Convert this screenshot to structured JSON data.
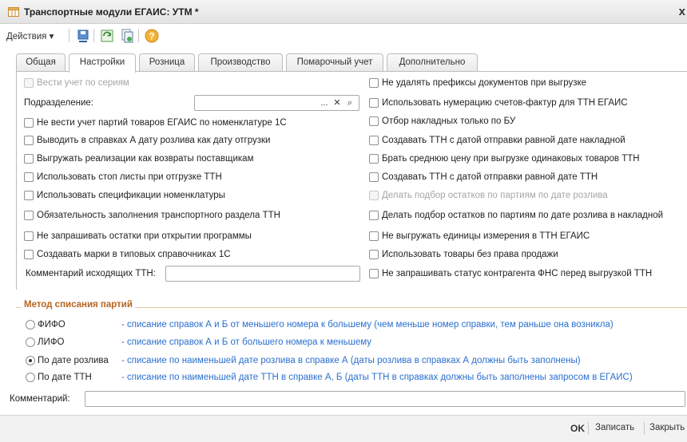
{
  "window": {
    "title": "Транспортные модули ЕГАИС: УТМ *",
    "close_glyph": "x"
  },
  "toolbar": {
    "actions_label": "Действия ▾",
    "icons": [
      "save-close-icon",
      "save-icon",
      "refresh-icon",
      "copy-icon",
      "help-icon"
    ]
  },
  "tabs": [
    {
      "label": "Общая"
    },
    {
      "label": "Настройки"
    },
    {
      "label": "Розница"
    },
    {
      "label": "Производство"
    },
    {
      "label": "Помарочный учет"
    },
    {
      "label": "Дополнительно"
    }
  ],
  "settings": {
    "series_label": "Вести учет по сериям",
    "division_label": "Подразделение:",
    "division_value": "",
    "division_dots": "...",
    "division_clear": "✕",
    "division_search": "⌕",
    "left": [
      "Не вести учет партий товаров ЕГАИС по номенклатуре 1С",
      "Выводить в справках А дату розлива как дату отгрузки",
      "Выгружать реализации как возвраты поставщикам",
      "Использовать стоп листы при отгрузке ТТН",
      "Использовать спецификации номенклатуры",
      "Обязательность заполнения транспортного раздела ТТН",
      "Не запрашивать остатки при открытии программы",
      "Создавать марки в типовых справочниках 1С"
    ],
    "comment_out_label": "Комментарий исходящих ТТН:",
    "comment_out_value": "",
    "right": [
      "Не удалять префиксы документов при выгрузке",
      "Использовать нумерацию счетов-фактур для ТТН ЕГАИС",
      "Отбор накладных только по БУ",
      "Создавать ТТН с датой отправки равной дате накладной",
      "Брать среднюю цену при выгрузке одинаковых товаров ТТН",
      "Создавать ТТН с датой отправки равной дате ТТН",
      "Делать подбор остатков по партиям по дате розлива",
      "Делать подбор остатков по партиям по дате розлива в накладной",
      "Не выгружать единицы измерения в ТТН ЕГАИС",
      "Использовать товары без права продажи",
      "Не запрашивать статус контрагента ФНС перед выгрузкой ТТН"
    ]
  },
  "write_off": {
    "title": "Метод списания партий",
    "options": [
      {
        "label": "ФИФО",
        "desc": "- списание справок А и Б от меньшего номера к большему (чем меньше номер справки, тем раньше она возникла)",
        "selected": false
      },
      {
        "label": "ЛИФО",
        "desc": "- списание справок А и Б от большего номера к меньшему",
        "selected": false
      },
      {
        "label": "По дате розлива",
        "desc": "- списание по наименьшей дате розлива в справке А (даты розлива в справках А должны быть заполнены)",
        "selected": true
      },
      {
        "label": "По дате ТТН",
        "desc": "- списание по наименьшей дате ТТН в справке А, Б (даты ТТН в справках должны быть заполнены запросом в ЕГАИС)",
        "selected": false
      }
    ]
  },
  "comment": {
    "label": "Комментарий:",
    "value": ""
  },
  "footer": {
    "ok": "OK",
    "save": "Записать",
    "close": "Закрыть"
  }
}
